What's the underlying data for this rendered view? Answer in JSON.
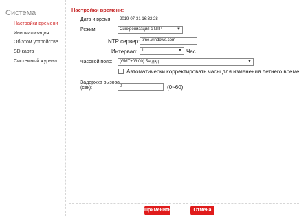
{
  "sidebar": {
    "title": "Система",
    "items": [
      {
        "label": "Настройки времени"
      },
      {
        "label": "Инициализация"
      },
      {
        "label": "Об этом устройстве"
      },
      {
        "label": "SD карта"
      },
      {
        "label": "Системный журнал"
      }
    ]
  },
  "form": {
    "section_title": "Настройки времени:",
    "datetime_label": "Дата и время:",
    "datetime_value": "2019-07-31 16:32:28",
    "mode_label": "Режим:",
    "mode_value": "Синхронизация с NTP",
    "ntp_label": "NTP сервер:",
    "ntp_value": "time.windows.com",
    "interval_label": "Интервал:",
    "interval_value": "1",
    "interval_unit": "Час",
    "timezone_label": "Часовой пояс:",
    "timezone_value": "(GMT+03:00) Багдад",
    "dst_label": "Автоматически корректировать часы для изменения летнего времени",
    "delay_label_1": "Задержка вызова",
    "delay_label_2": "(сек):",
    "delay_value": "0",
    "delay_range": "(0~60)"
  },
  "buttons": {
    "apply": "Применить",
    "cancel": "Отмена"
  },
  "colors": {
    "accent": "#e01b1b",
    "active_item": "#d12a2a"
  }
}
